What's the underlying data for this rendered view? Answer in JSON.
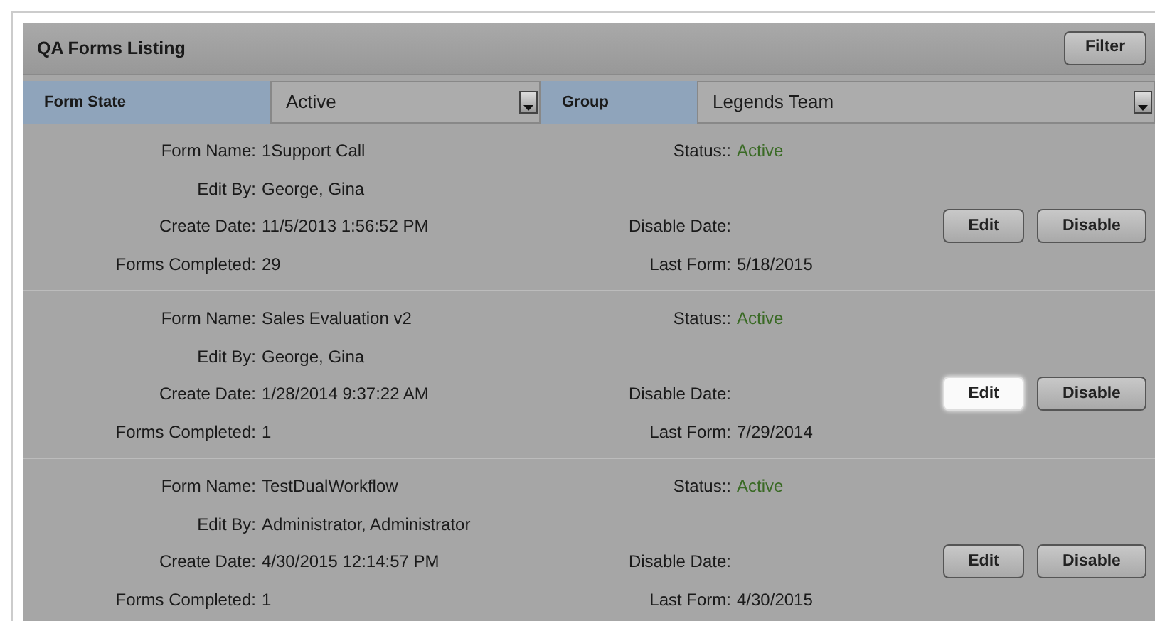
{
  "header": {
    "title": "QA Forms Listing",
    "filter_button": "Filter"
  },
  "filters": [
    {
      "label": "Form State",
      "value": "Active"
    },
    {
      "label": "Group",
      "value": "Legends Team"
    }
  ],
  "forms": [
    {
      "left": [
        {
          "label": "Form Name:",
          "value": "1Support Call"
        },
        {
          "label": "Edit By:",
          "value": "George, Gina"
        },
        {
          "label": "Create Date:",
          "value": "11/5/2013 1:56:52 PM"
        },
        {
          "label": "Forms Completed:",
          "value": "29"
        }
      ],
      "right": [
        {
          "label": "Status::",
          "value": "Active",
          "kind": "status"
        },
        {
          "label": "Disable Date:"
        },
        {
          "label": "Last Form:",
          "value": "5/18/2015"
        }
      ],
      "buttons": [
        {
          "label": "Edit",
          "selected": false
        },
        {
          "label": "Disable",
          "selected": false
        }
      ]
    },
    {
      "left": [
        {
          "label": "Form Name:",
          "value": "Sales Evaluation v2"
        },
        {
          "label": "Edit By:",
          "value": "George, Gina"
        },
        {
          "label": "Create Date:",
          "value": "1/28/2014 9:37:22 AM"
        },
        {
          "label": "Forms Completed:",
          "value": "1"
        }
      ],
      "right": [
        {
          "label": "Status::",
          "value": "Active",
          "kind": "status"
        },
        {
          "label": "Disable Date:"
        },
        {
          "label": "Last Form:",
          "value": "7/29/2014"
        }
      ],
      "buttons": [
        {
          "label": "Edit",
          "selected": true
        },
        {
          "label": "Disable",
          "selected": false
        }
      ]
    },
    {
      "left": [
        {
          "label": "Form Name:",
          "value": "TestDualWorkflow"
        },
        {
          "label": "Edit By:",
          "value": "Administrator, Administrator"
        },
        {
          "label": "Create Date:",
          "value": "4/30/2015 12:14:57 PM"
        },
        {
          "label": "Forms Completed:",
          "value": "1"
        }
      ],
      "right": [
        {
          "label": "Status::",
          "value": "Active",
          "kind": "status"
        },
        {
          "label": "Disable Date:"
        },
        {
          "label": "Last Form:",
          "value": "4/30/2015"
        }
      ],
      "buttons": [
        {
          "label": "Edit",
          "selected": false
        },
        {
          "label": "Disable",
          "selected": false
        }
      ]
    }
  ]
}
